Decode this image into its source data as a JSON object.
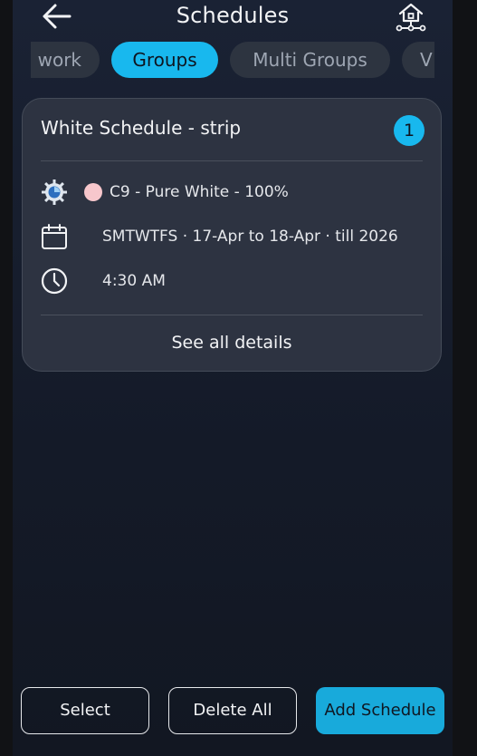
{
  "header": {
    "title": "Schedules",
    "back_icon": "arrow-left-icon",
    "home_icon": "home-network-icon"
  },
  "tabs": [
    {
      "label": "Network",
      "visible_label": "work",
      "active": false
    },
    {
      "label": "Groups",
      "active": true
    },
    {
      "label": "Multi Groups",
      "active": false
    },
    {
      "label": "V",
      "active": false
    }
  ],
  "schedule_card": {
    "title": "White Schedule - strip",
    "count": "1",
    "effect": {
      "icon": "effect-gear-icon",
      "swatch_color": "#f7c7cc",
      "text": "C9 - Pure White - 100%"
    },
    "days": {
      "icon": "calendar-icon",
      "text": "SMTWTFS · 17-Apr to 18-Apr · till 2026"
    },
    "time": {
      "icon": "clock-icon",
      "text": "4:30 AM"
    },
    "details_label": "See all details"
  },
  "footer": {
    "select_label": "Select",
    "delete_all_label": "Delete All",
    "add_label": "Add Schedule"
  },
  "colors": {
    "accent": "#18b8ee",
    "background": "#1a2234",
    "card": "#2d3341"
  }
}
